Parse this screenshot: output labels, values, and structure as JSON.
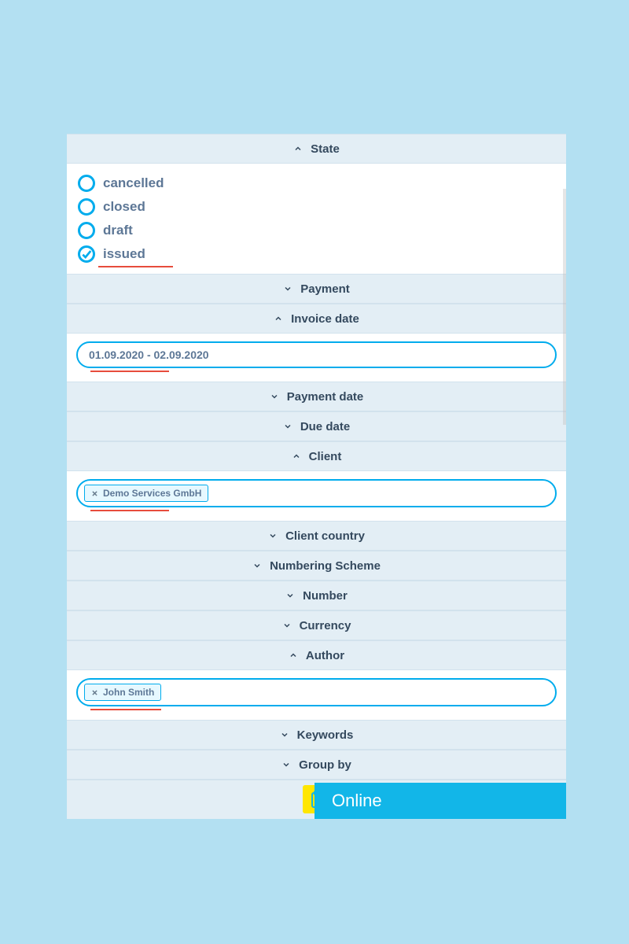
{
  "sections": {
    "state": {
      "label": "State",
      "expanded": true
    },
    "payment": {
      "label": "Payment",
      "expanded": false
    },
    "invoice_date": {
      "label": "Invoice date",
      "expanded": true
    },
    "payment_date": {
      "label": "Payment date",
      "expanded": false
    },
    "due_date": {
      "label": "Due date",
      "expanded": false
    },
    "client": {
      "label": "Client",
      "expanded": true
    },
    "client_country": {
      "label": "Client country",
      "expanded": false
    },
    "numbering_scheme": {
      "label": "Numbering Scheme",
      "expanded": false
    },
    "number": {
      "label": "Number",
      "expanded": false
    },
    "currency": {
      "label": "Currency",
      "expanded": false
    },
    "author": {
      "label": "Author",
      "expanded": true
    },
    "keywords": {
      "label": "Keywords",
      "expanded": false
    },
    "group_by": {
      "label": "Group by",
      "expanded": false
    }
  },
  "state_options": {
    "o0": {
      "label": "cancelled",
      "checked": false
    },
    "o1": {
      "label": "closed",
      "checked": false
    },
    "o2": {
      "label": "draft",
      "checked": false
    },
    "o3": {
      "label": "issued",
      "checked": true
    }
  },
  "invoice_date": {
    "value": "01.09.2020 - 02.09.2020"
  },
  "client": {
    "tag0": "Demo Services GmbH"
  },
  "author": {
    "tag0": "John Smith"
  },
  "status": {
    "label": "Online"
  }
}
